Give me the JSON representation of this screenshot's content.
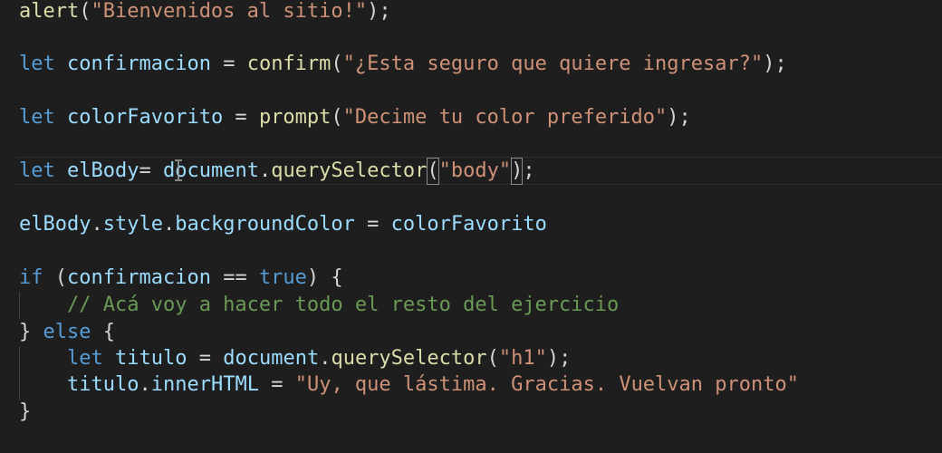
{
  "code": {
    "language": "javascript",
    "lines": [
      "alert(\"Bienvenidos al sitio!\");",
      "",
      "let confirmacion = confirm(\"¿Esta seguro que quiere ingresar?\");",
      "",
      "let colorFavorito = prompt(\"Decime tu color preferido\");",
      "",
      "let elBody= document.querySelector(\"body\");",
      "",
      "elBody.style.backgroundColor = colorFavorito",
      "",
      "if (confirmacion == true) {",
      "    // Acá voy a hacer todo el resto del ejercicio",
      "} else {",
      "    let titulo = document.querySelector(\"h1\");",
      "    titulo.innerHTML = \"Uy, que lástima. Gracias. Vuelvan pronto\"",
      "}"
    ],
    "tokens": {
      "l1": {
        "fn": "alert",
        "open": "(",
        "str": "\"Bienvenidos al sitio!\"",
        "close": ");"
      },
      "l3": {
        "kw": "let",
        "var": "confirmacion",
        "eq": " = ",
        "fn": "confirm",
        "open": "(",
        "str": "\"¿Esta seguro que quiere ingresar?\"",
        "close": ");"
      },
      "l5": {
        "kw": "let",
        "var": "colorFavorito",
        "eq": " = ",
        "fn": "prompt",
        "open": "(",
        "str": "\"Decime tu color preferido\"",
        "close": ");"
      },
      "l7": {
        "kw": "let",
        "var": "elBody",
        "eq": "= ",
        "obj": "document",
        "dot": ".",
        "fn": "querySelector",
        "open": "(",
        "str": "\"body\"",
        "close": ")",
        "semi": ";"
      },
      "l9": {
        "obj": "elBody",
        "dot1": ".",
        "prop1": "style",
        "dot2": ".",
        "prop2": "backgroundColor",
        "eq": " = ",
        "var": "colorFavorito"
      },
      "l11": {
        "kw": "if",
        "open": " (",
        "var": "confirmacion",
        "op": " == ",
        "lit": "true",
        "close": ") {"
      },
      "l12": {
        "comment": "// Acá voy a hacer todo el resto del ejercicio"
      },
      "l13": {
        "close": "} ",
        "kw": "else",
        "open": " {"
      },
      "l14": {
        "kw": "let",
        "var": "titulo",
        "eq": " = ",
        "obj": "document",
        "dot": ".",
        "fn": "querySelector",
        "open": "(",
        "str": "\"h1\"",
        "close": ");"
      },
      "l15": {
        "obj": "titulo",
        "dot": ".",
        "prop": "innerHTML",
        "eq": " = ",
        "str": "\"Uy, que lástima. Gracias. Vuelvan pronto\""
      },
      "l16": {
        "close": "}"
      }
    }
  },
  "theme": {
    "background": "#1e1e1e",
    "keyword": "#569cd6",
    "variable": "#9cdcfe",
    "function": "#dcdcaa",
    "string": "#ce9178",
    "comment": "#6a9955",
    "text": "#d4d4d4"
  },
  "cursor": {
    "icon": "text-cursor-icon"
  }
}
